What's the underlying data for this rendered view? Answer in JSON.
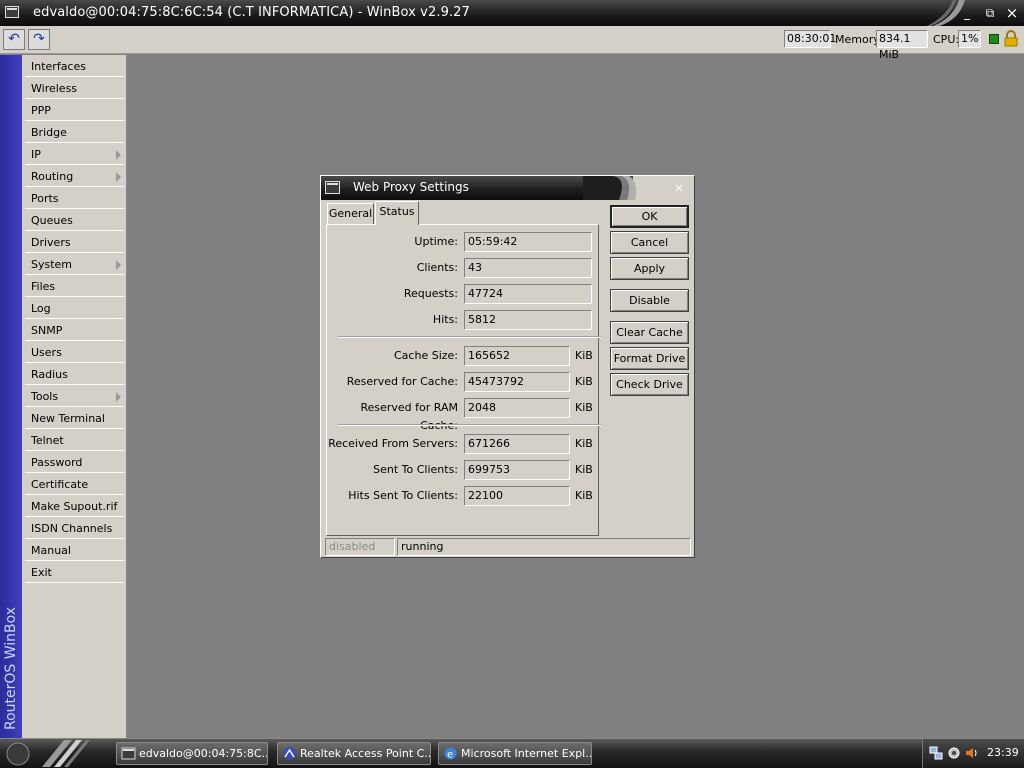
{
  "window": {
    "title": "edvaldo@00:04:75:8C:6C:54 (C.T INFORMATICA) - WinBox v2.9.27",
    "min_glyph": "_",
    "restore_glyph": "⧉",
    "close_glyph": "×"
  },
  "toolbar": {
    "undo_glyph": "↶",
    "redo_glyph": "↷",
    "time": "08:30:01",
    "memory_label": "Memory:",
    "memory_value": "834.1 MiB",
    "cpu_label": "CPU:",
    "cpu_value": "1%",
    "status_led_color": "#1c8a1c",
    "lock_color": "#e0b000"
  },
  "sidebar": {
    "brand": "RouterOS WinBox",
    "items": [
      {
        "label": "Interfaces"
      },
      {
        "label": "Wireless"
      },
      {
        "label": "PPP"
      },
      {
        "label": "Bridge"
      },
      {
        "label": "IP"
      },
      {
        "label": "Routing"
      },
      {
        "label": "Ports"
      },
      {
        "label": "Queues"
      },
      {
        "label": "Drivers"
      },
      {
        "label": "System"
      },
      {
        "label": "Files"
      },
      {
        "label": "Log"
      },
      {
        "label": "SNMP"
      },
      {
        "label": "Users"
      },
      {
        "label": "Radius"
      },
      {
        "label": "Tools"
      },
      {
        "label": "New Terminal"
      },
      {
        "label": "Telnet"
      },
      {
        "label": "Password"
      },
      {
        "label": "Certificate"
      },
      {
        "label": "Make Supout.rif"
      },
      {
        "label": "ISDN Channels"
      },
      {
        "label": "Manual"
      },
      {
        "label": "Exit"
      }
    ]
  },
  "dialog": {
    "title": "Web Proxy Settings",
    "close_glyph": "×",
    "tabs": [
      {
        "label": "General"
      },
      {
        "label": "Status"
      }
    ],
    "fields": {
      "uptime": {
        "label": "Uptime:",
        "value": "05:59:42"
      },
      "clients": {
        "label": "Clients:",
        "value": "43"
      },
      "requests": {
        "label": "Requests:",
        "value": "47724"
      },
      "hits": {
        "label": "Hits:",
        "value": "5812"
      },
      "cache_size": {
        "label": "Cache Size:",
        "value": "165652",
        "unit": "KiB"
      },
      "reserved_cache": {
        "label": "Reserved for Cache:",
        "value": "45473792",
        "unit": "KiB"
      },
      "reserved_ram": {
        "label": "Reserved for RAM Cache:",
        "value": "2048",
        "unit": "KiB"
      },
      "received_servers": {
        "label": "Received From Servers:",
        "value": "671266",
        "unit": "KiB"
      },
      "sent_clients": {
        "label": "Sent To Clients:",
        "value": "699753",
        "unit": "KiB"
      },
      "hits_sent": {
        "label": "Hits Sent To Clients:",
        "value": "22100",
        "unit": "KiB"
      }
    },
    "buttons": {
      "ok": "OK",
      "cancel": "Cancel",
      "apply": "Apply",
      "disable": "Disable",
      "clear_cache": "Clear Cache",
      "format_drive": "Format Drive",
      "check_drive": "Check Drive"
    },
    "statusbar": {
      "left": "disabled",
      "right": "running"
    }
  },
  "taskbar": {
    "tasks": [
      {
        "label": "edvaldo@00:04:75:8C..."
      },
      {
        "label": "Realtek Access Point C..."
      },
      {
        "label": "Microsoft Internet Expl..."
      }
    ],
    "clock": "23:39"
  }
}
